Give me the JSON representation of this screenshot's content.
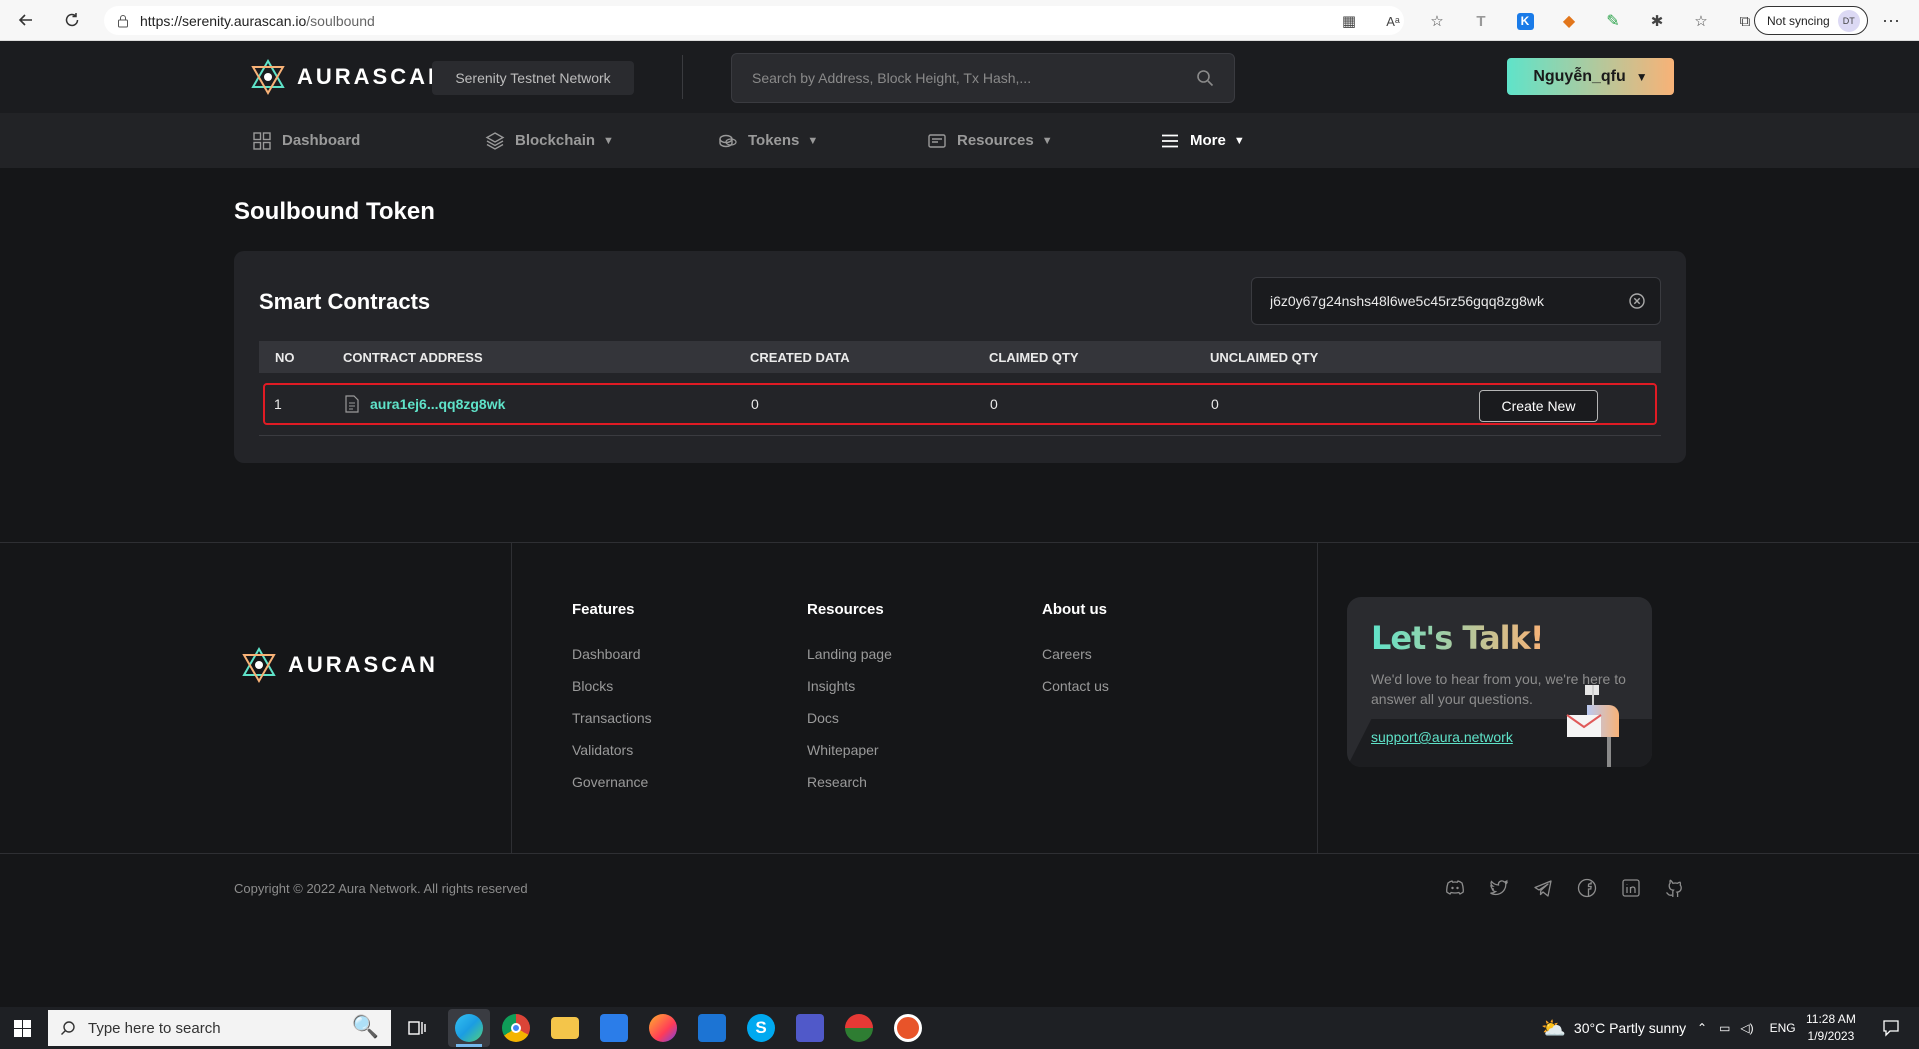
{
  "browser": {
    "url_host": "https://serenity.aurascan.io",
    "url_path": "/soulbound",
    "sync_label": "Not syncing",
    "profile_initials": "DT"
  },
  "header": {
    "logo_text": "AURASCAN",
    "network": "Serenity Testnet Network",
    "search_placeholder": "Search by Address, Block Height, Tx Hash,...",
    "user_name": "Nguyễn_qfu"
  },
  "nav": {
    "items": [
      {
        "label": "Dashboard",
        "icon": "grid-icon"
      },
      {
        "label": "Blockchain",
        "icon": "layers-icon"
      },
      {
        "label": "Tokens",
        "icon": "coins-icon"
      },
      {
        "label": "Resources",
        "icon": "resources-icon"
      },
      {
        "label": "More",
        "icon": "menu-icon"
      }
    ]
  },
  "page": {
    "title": "Soulbound Token",
    "card_title": "Smart Contracts",
    "search_value": "j6z0y67g24nshs48l6we5c45rz56gqq8zg8wk",
    "columns": [
      "NO",
      "CONTRACT ADDRESS",
      "CREATED DATA",
      "CLAIMED QTY",
      "UNCLAIMED QTY"
    ],
    "rows": [
      {
        "no": "1",
        "address": "aura1ej6...qq8zg8wk",
        "created": "0",
        "claimed": "0",
        "unclaimed": "0",
        "action": "Create New"
      }
    ]
  },
  "footer": {
    "logo_text": "AURASCAN",
    "features": {
      "title": "Features",
      "links": [
        "Dashboard",
        "Blocks",
        "Transactions",
        "Validators",
        "Governance"
      ]
    },
    "resources": {
      "title": "Resources",
      "links": [
        "Landing page",
        "Insights",
        "Docs",
        "Whitepaper",
        "Research"
      ]
    },
    "about": {
      "title": "About us",
      "links": [
        "Careers",
        "Contact us"
      ]
    },
    "talk": {
      "title": "Let's Talk!",
      "text": "We'd love to hear from you, we're here to answer all your questions.",
      "email": "support@aura.network"
    },
    "copyright": "Copyright © 2022 Aura Network. All rights reserved",
    "social": [
      "discord-icon",
      "twitter-icon",
      "telegram-icon",
      "facebook-icon",
      "linkedin-icon",
      "github-icon"
    ]
  },
  "taskbar": {
    "search_placeholder": "Type here to search",
    "weather": "30°C  Partly sunny",
    "lang": "ENG",
    "time": "11:28 AM",
    "date": "1/9/2023"
  },
  "colors": {
    "accent_teal": "#5fe3c9",
    "accent_orange": "#f8b277",
    "highlight_red": "#e01b24",
    "background": "#151618",
    "card": "#232428"
  }
}
